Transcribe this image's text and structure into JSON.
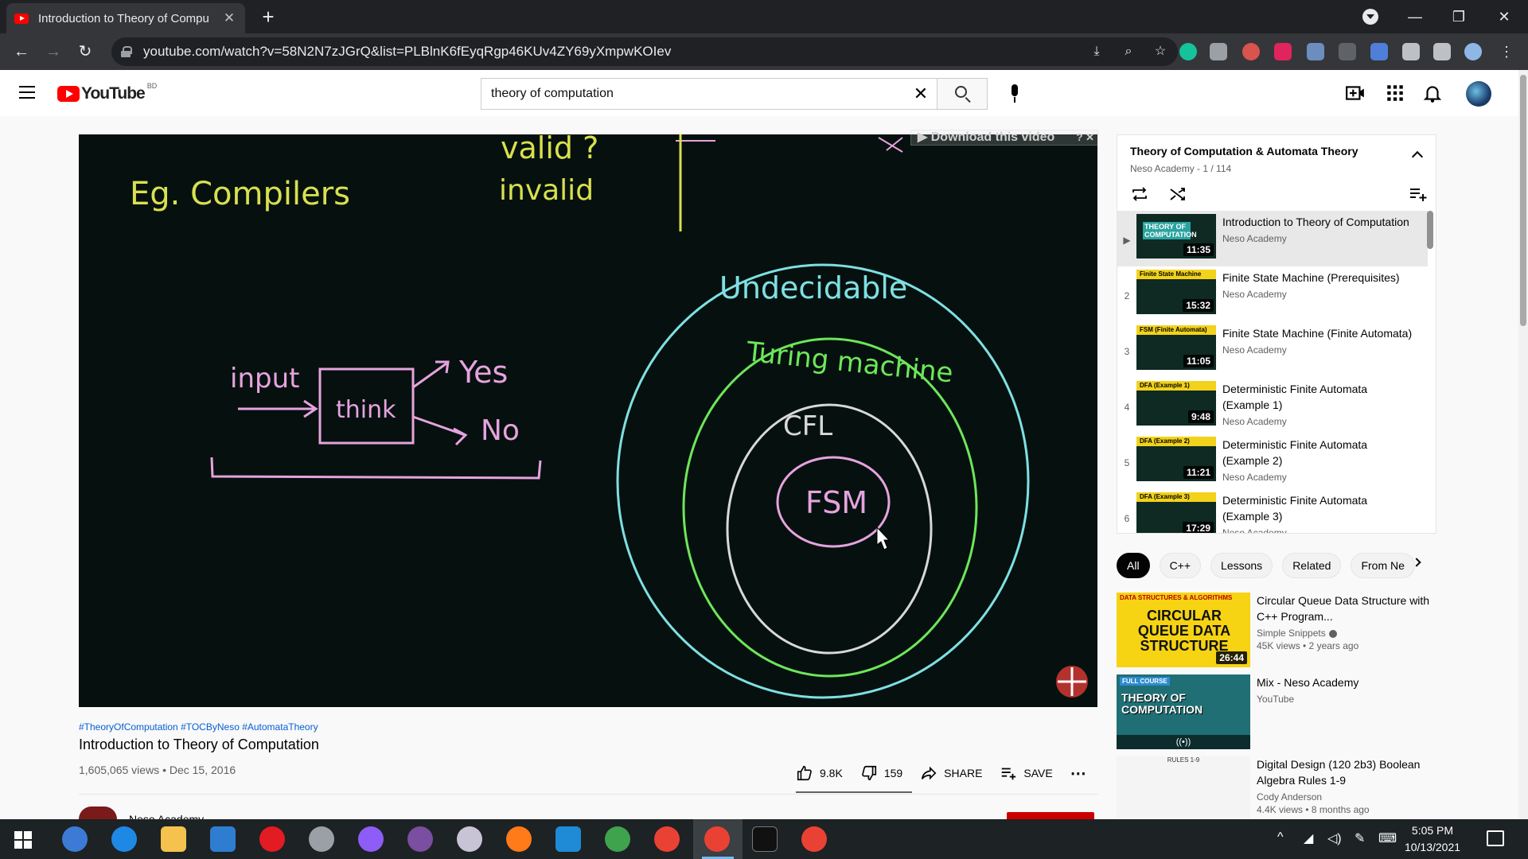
{
  "browser": {
    "tab_title": "Introduction to Theory of Compu",
    "url": "youtube.com/watch?v=58N2N7zJGrQ&list=PLBlnK6fEyqRgp46KUv4ZY69yXmpwKOIev"
  },
  "header": {
    "logo_text": "YouTube",
    "region": "BD",
    "search_value": "theory of computation"
  },
  "video": {
    "overlay_label": "▶ Download this video",
    "board": {
      "compilers": "Eg. Compilers",
      "valid": "valid ?",
      "invalid": "invalid",
      "input": "input",
      "think": "think",
      "yes": "Yes",
      "no": "No",
      "undecidable": "Undecidable",
      "turing": "Turing machine",
      "cfl": "CFL",
      "fsm": "FSM"
    },
    "hashtags": "#TheoryOfComputation #TOCByNeso #AutomataTheory",
    "title": "Introduction to Theory of Computation",
    "meta": "1,605,065 views • Dec 15, 2016",
    "likes": "9.8K",
    "dislikes": "159",
    "share_label": "SHARE",
    "save_label": "SAVE",
    "channel": "Neso Academy"
  },
  "playlist": {
    "title": "Theory of Computation & Automata Theory",
    "subtitle": "Neso Academy - 1 / 114",
    "items": [
      {
        "index": "▶",
        "title": "Introduction to Theory of Computation",
        "channel": "Neso Academy",
        "duration": "11:35",
        "thumb_label": "THEORY OF COMPUTATION"
      },
      {
        "index": "2",
        "title": "Finite State Machine (Prerequisites)",
        "channel": "Neso Academy",
        "duration": "15:32",
        "thumb_label": "Finite State Machine (Prerequisites)"
      },
      {
        "index": "3",
        "title": "Finite State Machine (Finite Automata)",
        "channel": "Neso Academy",
        "duration": "11:05",
        "thumb_label": "FSM (Finite Automata)"
      },
      {
        "index": "4",
        "title": "Deterministic Finite Automata (Example 1)",
        "channel": "Neso Academy",
        "duration": "9:48",
        "thumb_label": "DFA (Example 1)"
      },
      {
        "index": "5",
        "title": "Deterministic Finite Automata (Example 2)",
        "channel": "Neso Academy",
        "duration": "11:21",
        "thumb_label": "DFA (Example 2)"
      },
      {
        "index": "6",
        "title": "Deterministic Finite Automata (Example 3)",
        "channel": "Neso Academy",
        "duration": "17:29",
        "thumb_label": "DFA (Example 3)"
      }
    ]
  },
  "chips": [
    "All",
    "C++",
    "Lessons",
    "Related",
    "From Ne"
  ],
  "related": [
    {
      "title": "Circular Queue Data Structure with C++ Program...",
      "channel": "Simple Snippets",
      "meta": "45K views • 2 years ago",
      "duration": "26:44",
      "thumb_top": "DATA STRUCTURES & ALGORITHMS",
      "thumb_main": "CIRCULAR QUEUE DATA STRUCTURE"
    },
    {
      "title": "Mix - Neso Academy",
      "channel": "YouTube",
      "meta": "",
      "duration": "",
      "thumb_top": "FULL COURSE",
      "thumb_main": "THEORY OF COMPUTATION"
    },
    {
      "title": "Digital Design (120 2b3) Boolean Algebra Rules 1-9",
      "channel": "Cody Anderson",
      "meta": "4.4K views • 8 months ago",
      "duration": "",
      "thumb_top": "RULES 1-9",
      "thumb_main": ""
    }
  ],
  "taskbar": {
    "time": "5:05 PM",
    "date": "10/13/2021"
  },
  "colors": {
    "yt_red": "#ff0000",
    "link_blue": "#065fd4",
    "board_yellow": "#d9e04f",
    "board_pink": "#e6a3de",
    "board_cyan": "#7fe0e3",
    "board_green": "#6ee65a"
  }
}
